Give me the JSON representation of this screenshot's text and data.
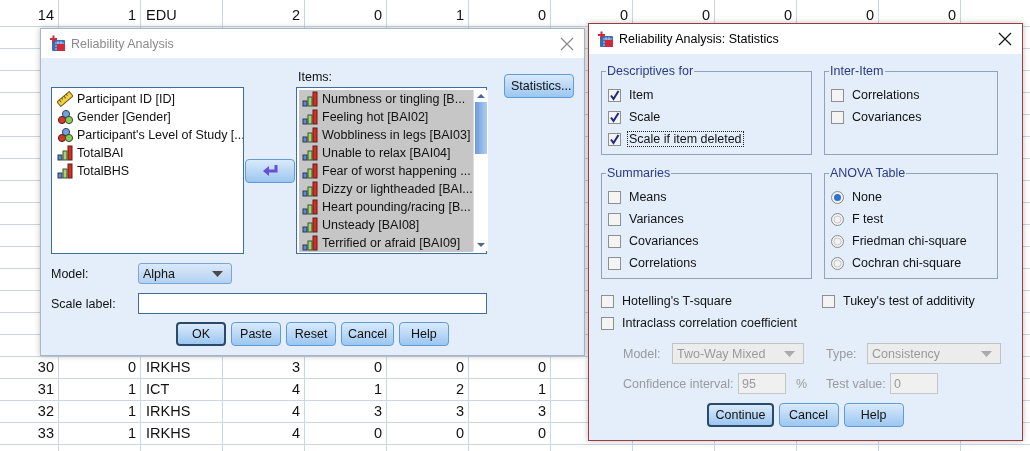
{
  "spreadsheet": {
    "rows": [
      {
        "cells": [
          "14",
          "1",
          "EDU",
          "2",
          "0",
          "1",
          "0",
          "0",
          "0",
          "0",
          "0",
          "0"
        ]
      },
      {
        "cells": [
          "30",
          "0",
          "IRKHS",
          "3",
          "0",
          "0",
          "0"
        ]
      },
      {
        "cells": [
          "31",
          "1",
          "ICT",
          "4",
          "1",
          "2",
          "1"
        ]
      },
      {
        "cells": [
          "32",
          "1",
          "IRKHS",
          "4",
          "3",
          "3",
          "3"
        ]
      },
      {
        "cells": [
          "33",
          "1",
          "IRKHS",
          "4",
          "0",
          "0",
          "0"
        ]
      }
    ]
  },
  "reliability_dialog": {
    "title": "Reliability Analysis",
    "active": false,
    "variables": [
      {
        "label": "Participant ID [ID]",
        "kind": "scale",
        "selected": false
      },
      {
        "label": "Gender [Gender]",
        "kind": "nominal",
        "selected": false
      },
      {
        "label": "Participant's Level of Study [...",
        "kind": "nominal",
        "selected": false
      },
      {
        "label": "TotalBAI",
        "kind": "ordinal",
        "selected": false
      },
      {
        "label": "TotalBHS",
        "kind": "ordinal",
        "selected": false
      }
    ],
    "items_label": "Items:",
    "items": [
      {
        "label": "Numbness or tingling [B...",
        "kind": "ordinal",
        "selected": true
      },
      {
        "label": "Feeling hot [BAI02]",
        "kind": "ordinal",
        "selected": true
      },
      {
        "label": "Wobbliness in legs [BAI03]",
        "kind": "ordinal",
        "selected": true
      },
      {
        "label": "Unable to relax [BAI04]",
        "kind": "ordinal",
        "selected": true
      },
      {
        "label": "Fear of worst happening ...",
        "kind": "ordinal",
        "selected": true
      },
      {
        "label": "Dizzy or lightheaded [BAI...",
        "kind": "ordinal",
        "selected": true
      },
      {
        "label": "Heart pounding/racing [B...",
        "kind": "ordinal",
        "selected": true
      },
      {
        "label": "Unsteady [BAI08]",
        "kind": "ordinal",
        "selected": true
      },
      {
        "label": "Terrified or afraid [BAI09]",
        "kind": "ordinal",
        "selected": true
      }
    ],
    "statistics_button": "Statistics...",
    "model_label": "Model:",
    "model_value": "Alpha",
    "scale_label": "Scale label:",
    "buttons": [
      {
        "label": "OK",
        "default": true
      },
      {
        "label": "Paste",
        "default": false
      },
      {
        "label": "Reset",
        "default": false
      },
      {
        "label": "Cancel",
        "default": false
      },
      {
        "label": "Help",
        "default": false
      }
    ]
  },
  "statistics_dialog": {
    "title": "Reliability Analysis: Statistics",
    "active": true,
    "groups": [
      {
        "title": "Descriptives for",
        "options": [
          {
            "label": "Item",
            "kind": "checkbox",
            "checked": true,
            "focused": false
          },
          {
            "label": "Scale",
            "kind": "checkbox",
            "checked": true,
            "focused": false
          },
          {
            "label": "Scale if item deleted",
            "kind": "checkbox",
            "checked": true,
            "focused": true
          }
        ]
      },
      {
        "title": "Inter-Item",
        "options": [
          {
            "label": "Correlations",
            "kind": "checkbox",
            "checked": false,
            "focused": false
          },
          {
            "label": "Covariances",
            "kind": "checkbox",
            "checked": false,
            "focused": false
          }
        ]
      },
      {
        "title": "Summaries",
        "options": [
          {
            "label": "Means",
            "kind": "checkbox",
            "checked": false,
            "focused": false
          },
          {
            "label": "Variances",
            "kind": "checkbox",
            "checked": false,
            "focused": false
          },
          {
            "label": "Covariances",
            "kind": "checkbox",
            "checked": false,
            "focused": false
          },
          {
            "label": "Correlations",
            "kind": "checkbox",
            "checked": false,
            "focused": false
          }
        ]
      },
      {
        "title": "ANOVA Table",
        "options": [
          {
            "label": "None",
            "kind": "radio",
            "selected": true,
            "focused": false
          },
          {
            "label": "F test",
            "kind": "radio",
            "selected": false,
            "focused": false
          },
          {
            "label": "Friedman chi-square",
            "kind": "radio",
            "selected": false,
            "focused": false
          },
          {
            "label": "Cochran chi-square",
            "kind": "radio",
            "selected": false,
            "focused": false
          }
        ]
      }
    ],
    "extras": [
      {
        "label": "Hotelling's T-square",
        "checked": false
      },
      {
        "label": "Tukey's test of additivity",
        "checked": false
      },
      {
        "label": "Intraclass correlation coefficient",
        "checked": false
      }
    ],
    "icc": {
      "disabled": true,
      "model_label": "Model:",
      "model_value": "Two-Way Mixed",
      "type_label": "Type:",
      "type_value": "Consistency",
      "ci_label": "Confidence interval:",
      "ci_value": "95",
      "ci_unit": "%",
      "test_label": "Test value:",
      "test_value": "0"
    },
    "buttons": [
      {
        "label": "Continue",
        "default": true
      },
      {
        "label": "Cancel",
        "default": false
      },
      {
        "label": "Help",
        "default": false
      }
    ]
  }
}
